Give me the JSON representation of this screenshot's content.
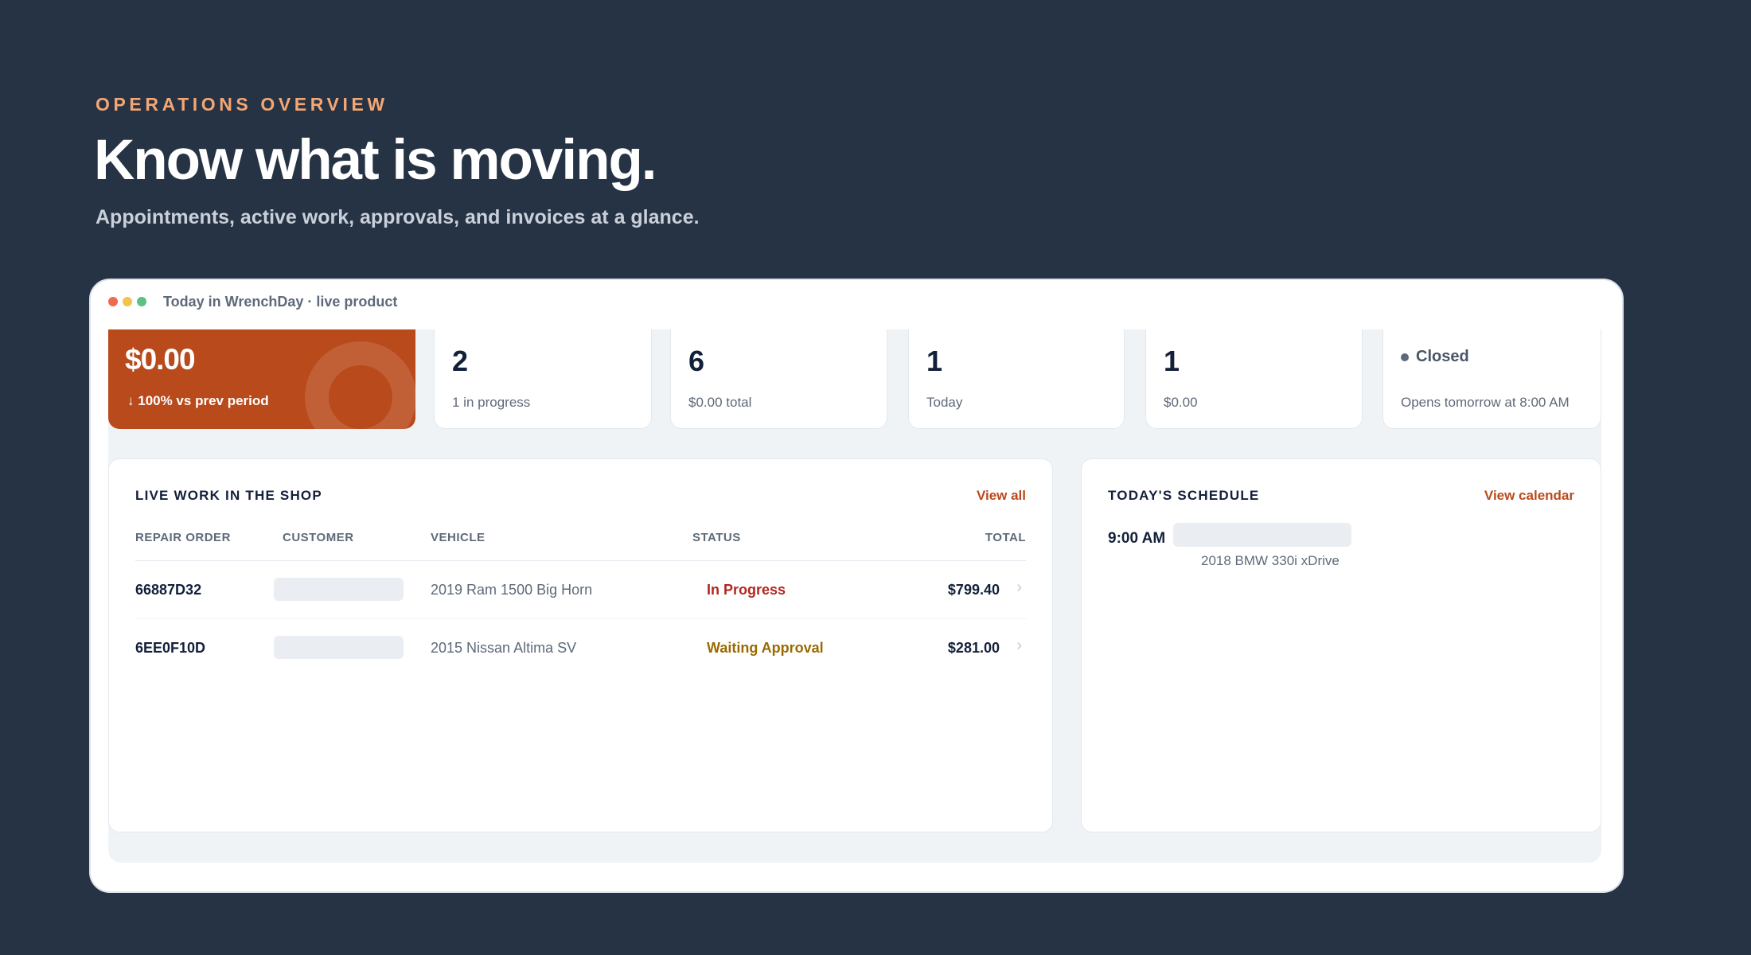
{
  "hero": {
    "eyebrow": "OPERATIONS OVERVIEW",
    "title": "Know what is moving.",
    "subtitle": "Appointments, active work, approvals, and invoices at a glance."
  },
  "window": {
    "title": "Today in WrenchDay · live product",
    "dot_colors": [
      "#ef6b4f",
      "#f5c34b",
      "#5bc184"
    ]
  },
  "kpis": [
    {
      "value": "$0.00",
      "sub": "100% vs prev period",
      "trend_icon": "arrow-down-icon"
    },
    {
      "value": "2",
      "sub": "1 in progress"
    },
    {
      "value": "6",
      "sub": "$0.00 total"
    },
    {
      "value": "1",
      "sub": "Today"
    },
    {
      "value": "1",
      "sub": "$0.00"
    },
    {
      "status": "Closed",
      "sub": "Opens tomorrow at 8:00 AM"
    }
  ],
  "live_work": {
    "title": "LIVE WORK IN THE SHOP",
    "link": "View all",
    "columns": [
      "REPAIR ORDER",
      "CUSTOMER",
      "VEHICLE",
      "STATUS",
      "TOTAL"
    ],
    "rows": [
      {
        "order": "66887D32",
        "vehicle": "2019 Ram 1500 Big Horn",
        "status": "In Progress",
        "status_color": "#b3261e",
        "total": "$799.40"
      },
      {
        "order": "6EE0F10D",
        "vehicle": "2015 Nissan Altima SV",
        "status": "Waiting Approval",
        "status_color": "#9a6a00",
        "total": "$281.00"
      }
    ]
  },
  "schedule": {
    "title": "TODAY'S SCHEDULE",
    "link": "View calendar",
    "items": [
      {
        "time": "9:00 AM",
        "vehicle": "2018 BMW 330i xDrive"
      }
    ]
  },
  "colors": {
    "background": "#263345",
    "accent": "#b94a1c",
    "eyebrow": "#f5a673"
  }
}
